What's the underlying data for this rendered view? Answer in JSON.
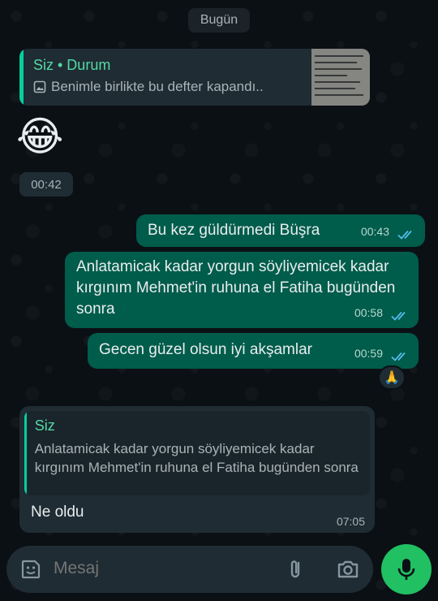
{
  "date_chip": "Bugün",
  "status_reply": {
    "sender": "Siz • Durum",
    "preview": "Benimle birlikte bu defter kapandı.."
  },
  "emoji_message": {
    "emoji": "😂",
    "time": "00:42"
  },
  "outgoing_messages": [
    {
      "text": "Bu kez güldürmedi Büşra",
      "time": "00:43"
    },
    {
      "text": "Anlatamicak kadar yorgun söyliyemicek kadar kırgınım Mehmet'in ruhuna el Fatiha bugünden sonra",
      "time": "00:58"
    },
    {
      "text": "Gecen güzel olsun iyi akşamlar",
      "time": "00:59"
    }
  ],
  "reaction_emoji": "🙏",
  "incoming_reply": {
    "quoted_sender": "Siz",
    "quoted_text": "Anlatamicak kadar yorgun söyliyemicek kadar kırgınım Mehmet'in ruhuna el Fatiha bugünden sonra",
    "text": "Ne oldu",
    "time": "07:05"
  },
  "composer": {
    "placeholder": "Mesaj"
  },
  "icons": {
    "emoji": "sticker-smile-icon",
    "attach": "paperclip-icon",
    "camera": "camera-icon",
    "send": "microphone-icon",
    "read": "double-check-icon",
    "image": "image-icon"
  },
  "colors": {
    "background": "#0b1014",
    "outgoing_bubble": "#005c4b",
    "incoming_bubble": "#1f2c33",
    "accent": "#21c063",
    "read_ticks": "#53bdeb"
  }
}
